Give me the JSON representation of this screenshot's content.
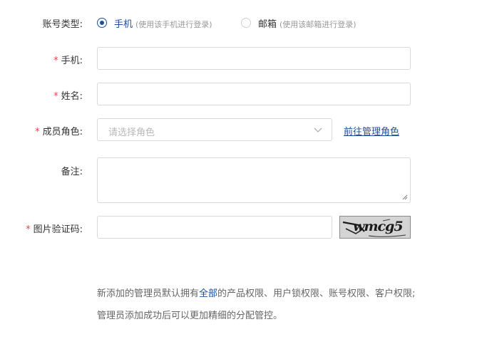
{
  "account_type": {
    "label": "账号类型:",
    "options": [
      {
        "text": "手机",
        "hint": "(使用该手机进行登录)",
        "selected": true
      },
      {
        "text": "邮箱",
        "hint": "(使用该邮箱进行登录)",
        "selected": false
      }
    ]
  },
  "phone": {
    "required_mark": "*",
    "label": "手机:",
    "value": "",
    "placeholder": ""
  },
  "name": {
    "required_mark": "*",
    "label": "姓名:",
    "value": "",
    "placeholder": ""
  },
  "role": {
    "required_mark": "*",
    "label": "成员角色:",
    "placeholder": "请选择角色",
    "manage_link": "前往管理角色"
  },
  "remark": {
    "label": "备注:",
    "value": ""
  },
  "captcha": {
    "required_mark": "*",
    "label": "图片验证码:",
    "value": "",
    "image_text": "wmcg5"
  },
  "notes": {
    "line1_prefix": "新添加的管理员默认拥有",
    "line1_highlight": "全部",
    "line1_suffix": "的产品权限、用户锁权限、账号权限、客户权限;",
    "line2": "管理员添加成功后可以更加精细的分配管控。"
  },
  "colors": {
    "accent": "#1f4e9e",
    "required": "#e64545",
    "border": "#d9d9d9",
    "hint": "#999999"
  }
}
